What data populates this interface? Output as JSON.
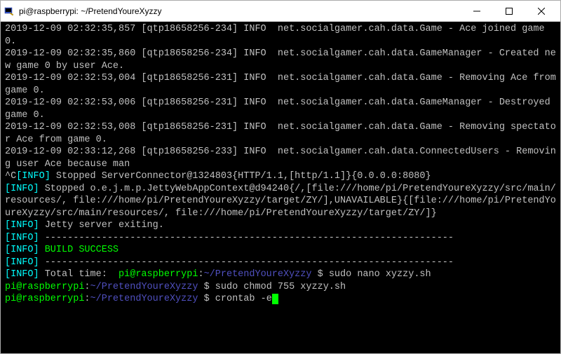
{
  "window": {
    "title": "pi@raspberrypi: ~/PretendYoureXyzzy",
    "icon": "putty-icon",
    "controls": {
      "minimize": "minimize",
      "maximize": "maximize",
      "close": "close"
    }
  },
  "terminal": {
    "logs": [
      "2019-12-09 02:32:35,857 [qtp18658256-234] INFO  net.socialgamer.cah.data.Game - Ace joined game 0.",
      "2019-12-09 02:32:35,860 [qtp18658256-234] INFO  net.socialgamer.cah.data.GameManager - Created new game 0 by user Ace.",
      "2019-12-09 02:32:53,004 [qtp18658256-231] INFO  net.socialgamer.cah.data.Game - Removing Ace from game 0.",
      "2019-12-09 02:32:53,006 [qtp18658256-231] INFO  net.socialgamer.cah.data.GameManager - Destroyed game 0.",
      "2019-12-09 02:32:53,008 [qtp18658256-231] INFO  net.socialgamer.cah.data.Game - Removing spectator Ace from game 0.",
      "2019-12-09 02:33:12,268 [qtp18658256-233] INFO  net.socialgamer.cah.data.ConnectedUsers - Removing user Ace because man"
    ],
    "interrupt_prefix": "^C",
    "interrupt_line": " Stopped ServerConnector@1324803{HTTP/1.1,[http/1.1]}{0.0.0.0:8080}",
    "info_label": "[INFO]",
    "info_stopped_jetty": " Stopped o.e.j.m.p.JettyWebAppContext@d94240{/,[file:///home/pi/PretendYoureXyzzy/src/main/resources/, file:///home/pi/PretendYoureXyzzy/target/ZY/],UNAVAILABLE}{[file:///home/pi/PretendYoureXyzzy/src/main/resources/, file:///home/pi/PretendYoureXyzzy/target/ZY/]}",
    "info_exiting": " Jetty server exiting.",
    "dashes1": " ------------------------------------------------------------------------",
    "build_success": " BUILD SUCCESS",
    "dashes2": " ------------------------------------------------------------------------",
    "total_time_label": " Total time:  ",
    "prompt_user": "pi@raspberrypi",
    "prompt_sep": ":",
    "prompt_path": "~/PretendYoureXyzzy",
    "prompt_dollar": " $ ",
    "cmd1": "sudo nano xyzzy.sh",
    "cmd2": "sudo chmod 755 xyzzy.sh",
    "cmd3": "crontab -e"
  }
}
